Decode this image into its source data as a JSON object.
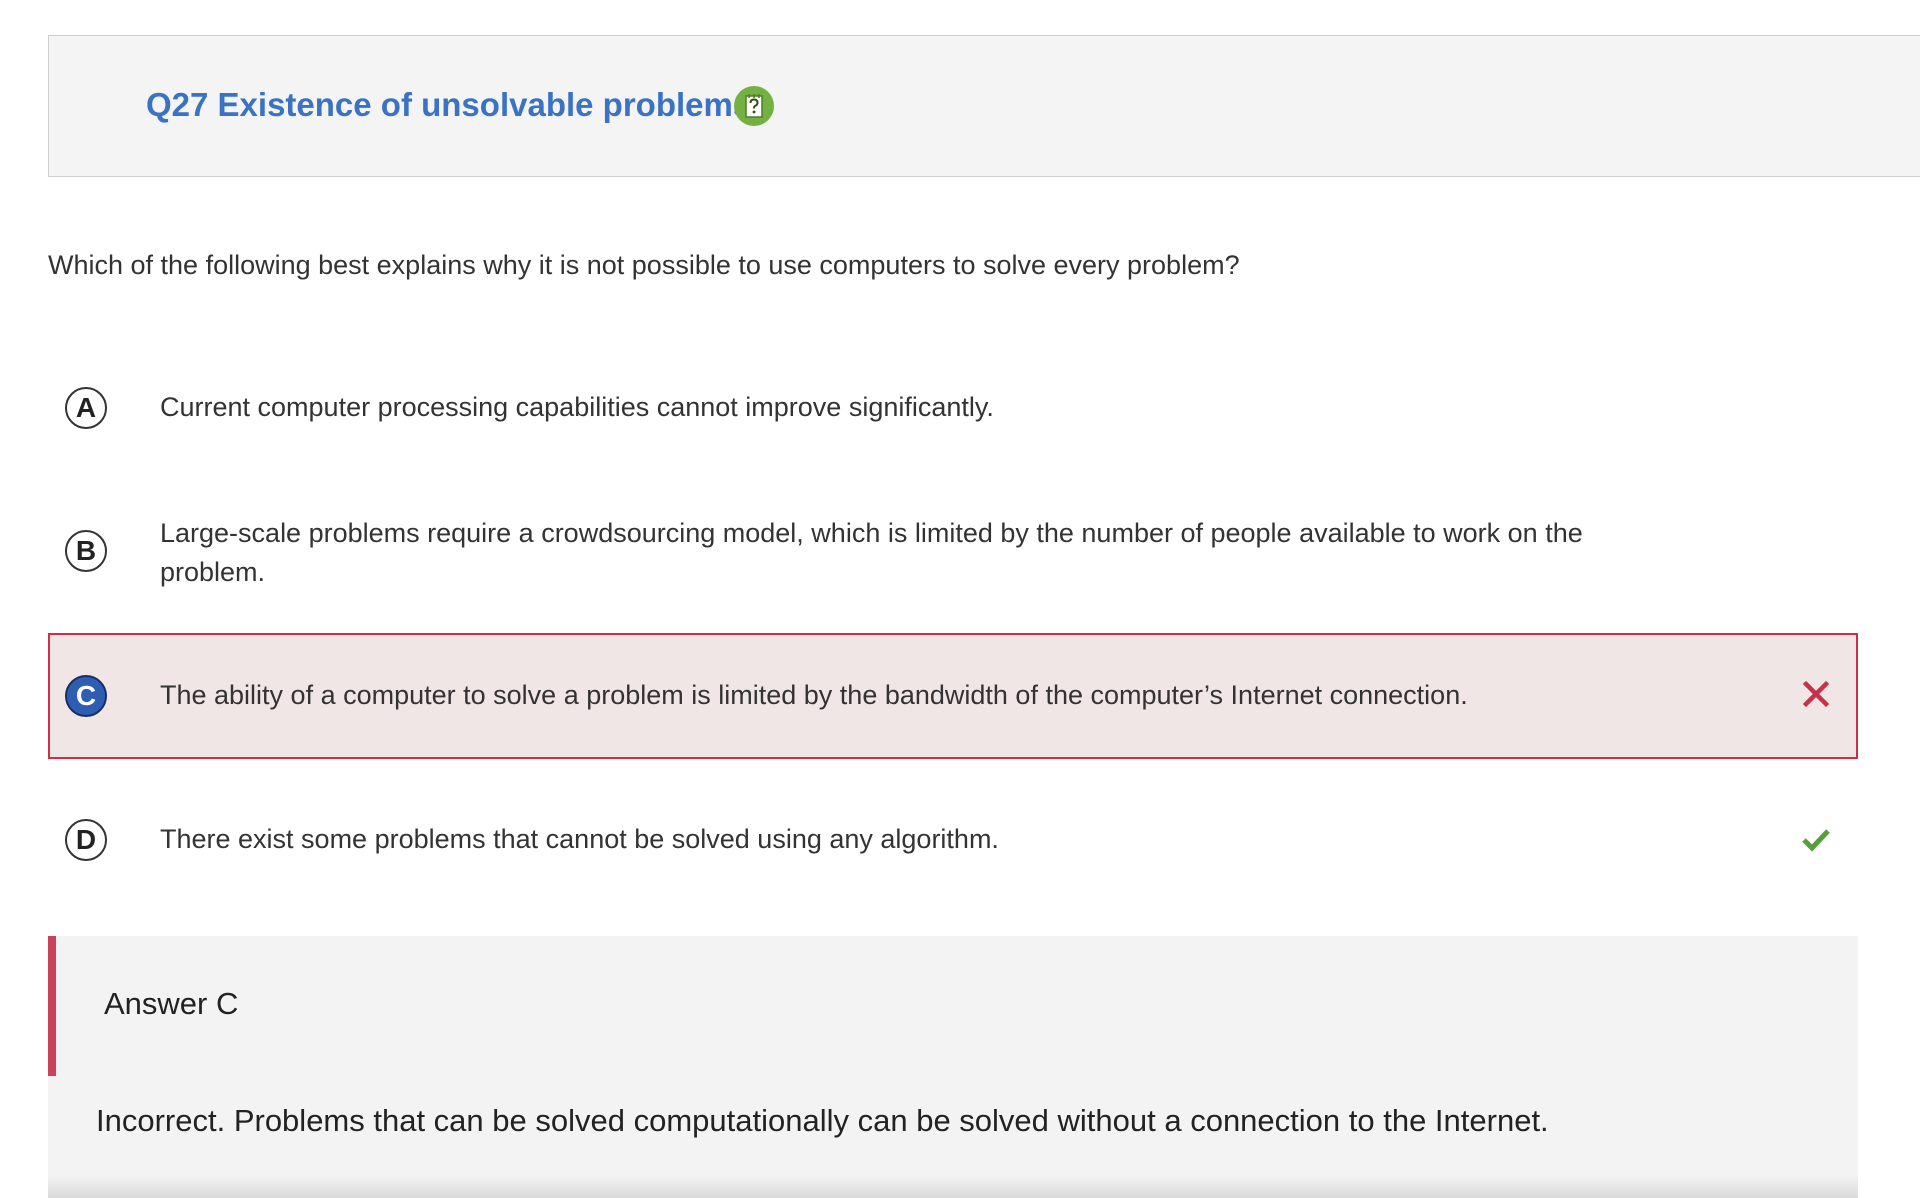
{
  "question": {
    "title": "Q27 Existence of unsolvable problems",
    "help_icon": "question-notepad-icon",
    "stem": "Which of the following best explains why it is not possible to use computers to solve every problem?"
  },
  "options": [
    {
      "letter": "A",
      "text": "Current computer processing capabilities cannot improve significantly."
    },
    {
      "letter": "B",
      "text": "Large-scale problems require a crowdsourcing model, which is limited by the number of people available to work on the problem."
    },
    {
      "letter": "C",
      "text": "The ability of a computer to solve a problem is limited by the bandwidth of the computer’s Internet connection.",
      "selected": true,
      "status": "incorrect",
      "status_icon": "x-icon"
    },
    {
      "letter": "D",
      "text": "There exist some problems that cannot be solved using any algorithm.",
      "status": "correct",
      "status_icon": "checkmark-icon"
    }
  ],
  "answer": {
    "title": "Answer C",
    "explanation": "Incorrect. Problems that can be solved computationally can be solved without a connection to the Internet."
  },
  "colors": {
    "title_blue": "#3a72c4",
    "help_green": "#75b043",
    "incorrect_red": "#c9304a",
    "incorrect_bg": "#f1e6e6",
    "selected_blue": "#2e5db4",
    "correct_green": "#5a9e3a"
  }
}
